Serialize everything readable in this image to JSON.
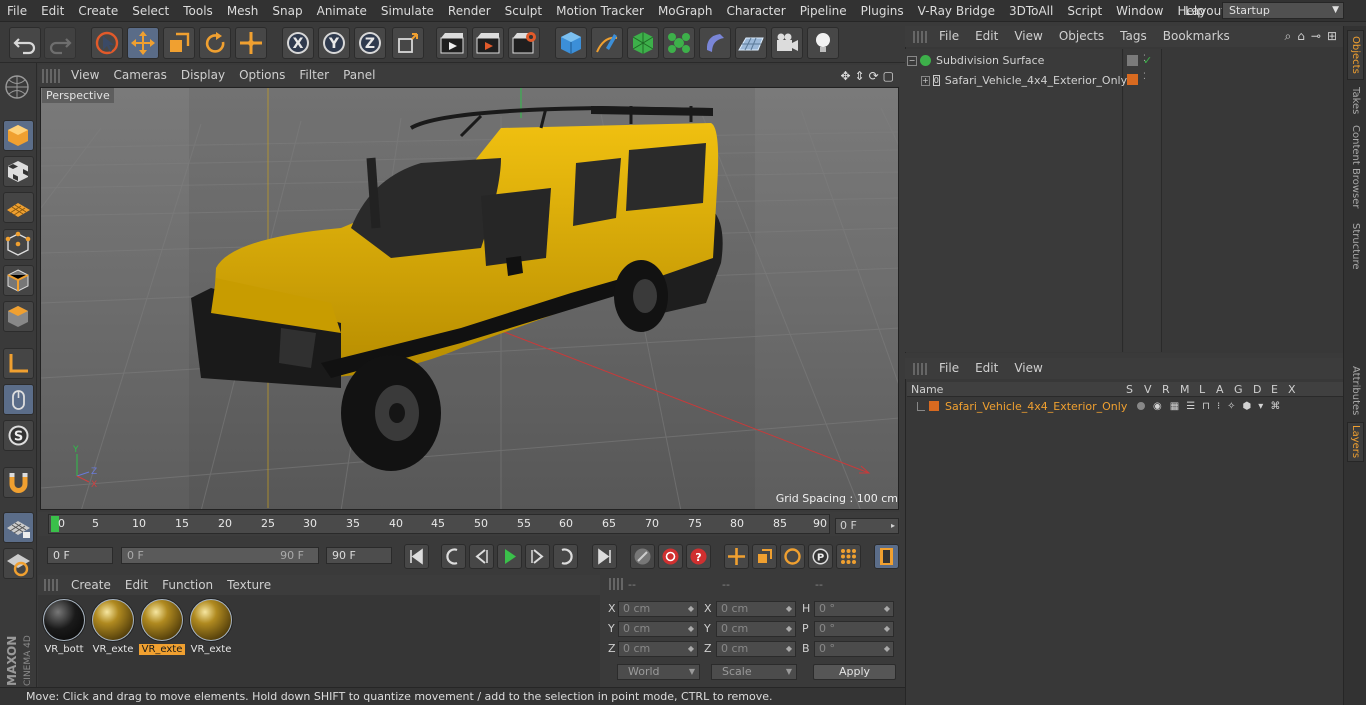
{
  "menubar": {
    "items": [
      "File",
      "Edit",
      "Create",
      "Select",
      "Tools",
      "Mesh",
      "Snap",
      "Animate",
      "Simulate",
      "Render",
      "Sculpt",
      "Motion Tracker",
      "MoGraph",
      "Character",
      "Pipeline",
      "Plugins",
      "V-Ray Bridge",
      "3DToAll",
      "Script",
      "Window",
      "Help"
    ],
    "layout_label": "Layout:",
    "layout_value": "Startup"
  },
  "viewport": {
    "menu": [
      "View",
      "Cameras",
      "Display",
      "Options",
      "Filter",
      "Panel"
    ],
    "label": "Perspective",
    "grid_spacing": "Grid Spacing : 100 cm"
  },
  "timeline": {
    "ticks": [
      "0",
      "5",
      "10",
      "15",
      "20",
      "25",
      "30",
      "35",
      "40",
      "45",
      "50",
      "55",
      "60",
      "65",
      "70",
      "75",
      "80",
      "85",
      "90"
    ],
    "current_frame": "0 F",
    "start_field": "0 F",
    "range_start": "0 F",
    "range_end": "90 F",
    "end_field": "90 F"
  },
  "materials": {
    "menu": [
      "Create",
      "Edit",
      "Function",
      "Texture"
    ],
    "items": [
      {
        "label": "VR_bott",
        "selected": false
      },
      {
        "label": "VR_exte",
        "selected": false
      },
      {
        "label": "VR_exte",
        "selected": true
      },
      {
        "label": "VR_exte",
        "selected": false
      }
    ]
  },
  "coords": {
    "headers": [
      "--",
      "--",
      "--"
    ],
    "rows": [
      {
        "a_label": "X",
        "a_val": "0 cm",
        "b_label": "X",
        "b_val": "0 cm",
        "c_label": "H",
        "c_val": "0 °"
      },
      {
        "a_label": "Y",
        "a_val": "0 cm",
        "b_label": "Y",
        "b_val": "0 cm",
        "c_label": "P",
        "c_val": "0 °"
      },
      {
        "a_label": "Z",
        "a_val": "0 cm",
        "b_label": "Z",
        "b_val": "0 cm",
        "c_label": "B",
        "c_val": "0 °"
      }
    ],
    "mode1": "World",
    "mode2": "Scale",
    "apply": "Apply"
  },
  "status": "Move: Click and drag to move elements. Hold down SHIFT to quantize movement / add to the selection in point mode, CTRL to remove.",
  "objects": {
    "menu": [
      "File",
      "Edit",
      "View",
      "Objects",
      "Tags",
      "Bookmarks"
    ],
    "tree": [
      {
        "name": "Subdivision Surface",
        "color": "#d2d2d2"
      },
      {
        "name": "Safari_Vehicle_4x4_Exterior_Only",
        "color": "#d2d2d2"
      }
    ]
  },
  "layers": {
    "menu": [
      "File",
      "Edit",
      "View"
    ],
    "columns": [
      "Name",
      "S",
      "V",
      "R",
      "M",
      "L",
      "A",
      "G",
      "D",
      "E",
      "X"
    ],
    "rows": [
      {
        "name": "Safari_Vehicle_4x4_Exterior_Only",
        "color": "#e08a30"
      }
    ]
  },
  "side_tabs": [
    "Objects",
    "Takes",
    "Content Browser",
    "Structure",
    "Attributes",
    "Layers"
  ],
  "brand": {
    "line1": "MAXON",
    "line2": "CINEMA 4D"
  },
  "colors": {
    "accent": "#f0a030",
    "selection": "#5b6d89",
    "vehicle": "#e0b000"
  }
}
